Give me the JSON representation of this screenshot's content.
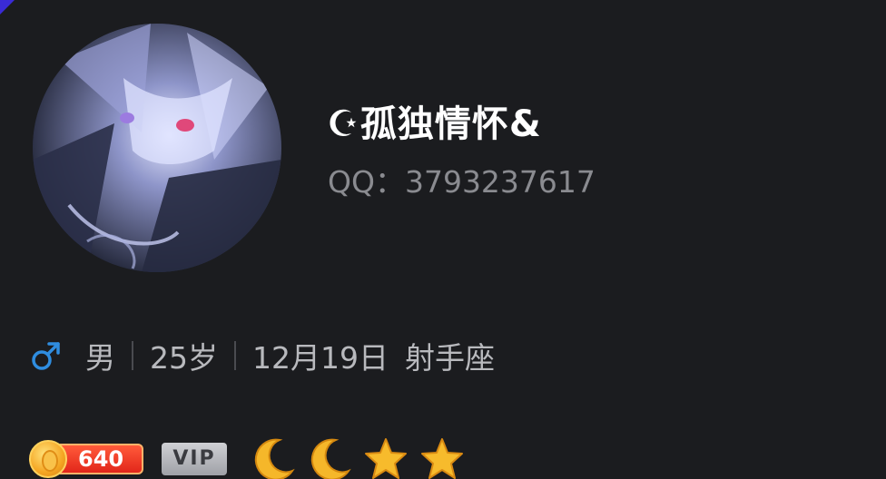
{
  "profile": {
    "nickname": "☪孤独情怀&",
    "qq_label": "QQ：",
    "qq_number": "3793237617",
    "gender": "男",
    "age": "25岁",
    "birthday": "12月19日",
    "zodiac": "射手座"
  },
  "badges": {
    "coins": "640",
    "vip_label": "VIP",
    "level_icons": [
      "moon-icon",
      "moon-icon",
      "star-icon",
      "star-icon"
    ]
  },
  "colors": {
    "background": "#1b1c1f",
    "gender_male": "#2f8de0",
    "coin_red": "#e2261a",
    "gold": "#f5a623"
  }
}
